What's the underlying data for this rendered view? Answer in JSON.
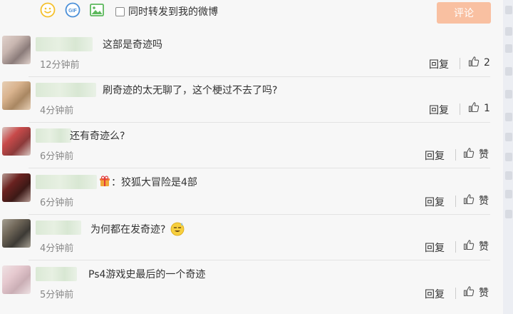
{
  "toolbar": {
    "emoji_icon": "smiley-icon",
    "gif_icon": "gif-icon",
    "gif_label": "GIF",
    "image_icon": "image-icon",
    "repost_label": "同时转发到我的微博",
    "repost_checked": false,
    "submit_label": "评论",
    "submit_color": "#f9c0a1"
  },
  "comments": [
    {
      "text": "这部是奇迹吗",
      "time": "12分钟前",
      "reply": "回复",
      "likes": "2"
    },
    {
      "text": "刷奇迹的太无聊了，这个梗过不去了吗?",
      "time": "4分钟前",
      "reply": "回复",
      "likes": "1"
    },
    {
      "text": "还有奇迹么?",
      "time": "6分钟前",
      "reply": "回复",
      "likes": "赞"
    },
    {
      "text": "：狡狐大冒险是4部",
      "time": "6分钟前",
      "reply": "回复",
      "likes": "赞",
      "badge_icon": "gift-badge-icon"
    },
    {
      "text": "为何都在发奇迹?",
      "time": "4分钟前",
      "reply": "回复",
      "likes": "赞",
      "emoji_icon": "sweat-smile-emoji-icon"
    },
    {
      "text": "Ps4游戏史最后的一个奇迹",
      "time": "5分钟前",
      "reply": "回复",
      "likes": "赞"
    }
  ],
  "colors": {
    "accent_orange": "#f9c0a1",
    "icon_yellow": "#f5c02b",
    "icon_blue": "#4a8fd8",
    "icon_green": "#5cb85c"
  }
}
